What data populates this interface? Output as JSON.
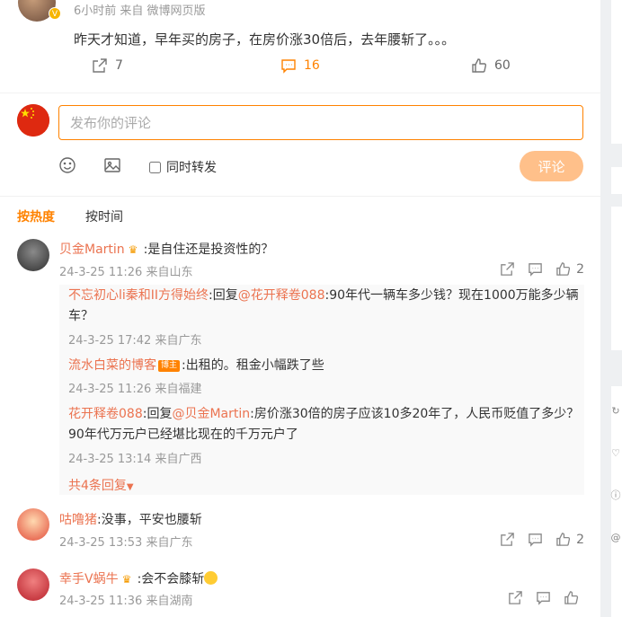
{
  "post": {
    "meta": "6小时前 来自 微博网页版",
    "text": "昨天才知道，早年买的房子，在房价涨30倍后，去年腰斩了。。。",
    "repost_count": "7",
    "comment_count": "16",
    "like_count": "60"
  },
  "composer": {
    "placeholder": "发布你的评论",
    "forward_label": "同时转发",
    "submit_label": "评论"
  },
  "sort": {
    "hot": "按热度",
    "time": "按时间"
  },
  "comments": [
    {
      "user": "贝金Martin",
      "text": ":是自住还是投资性的？",
      "meta": "24-3-25 11:26 来自山东",
      "likes": "2",
      "replies": [
        {
          "user": "不忘初心li秦和II方得始终",
          "prefix": ":回复",
          "mention": "@花开释卷088",
          "text": ":90年代一辆车多少钱？现在1000万能多少辆车？",
          "meta": "24-3-25 17:42 来自广东"
        },
        {
          "user": "流水白菜的博客",
          "tag": "博主",
          "text": ":出租的。租金小幅跌了些",
          "meta": "24-3-25 11:26 来自福建"
        },
        {
          "user": "花开释卷088",
          "prefix": ":回复",
          "mention": "@贝金Martin",
          "text": ":房价涨30倍的房子应该10多20年了，人民币贬值了多少？90年代万元户已经堪比现在的千万元户了",
          "meta": "24-3-25 13:14 来自广西"
        }
      ],
      "more_replies": "共4条回复"
    },
    {
      "user": "咕噜猪",
      "text": ":没事，平安也腰斩",
      "meta": "24-3-25 13:53 来自广东",
      "likes": "2"
    },
    {
      "user": "幸手V蜗牛",
      "text": ":会不会膝斩",
      "meta": "24-3-25 11:36 来自湖南",
      "likes": ""
    }
  ],
  "colors": {
    "accent": "#ff8200",
    "username": "#eb7350",
    "flag": "#de2910"
  }
}
